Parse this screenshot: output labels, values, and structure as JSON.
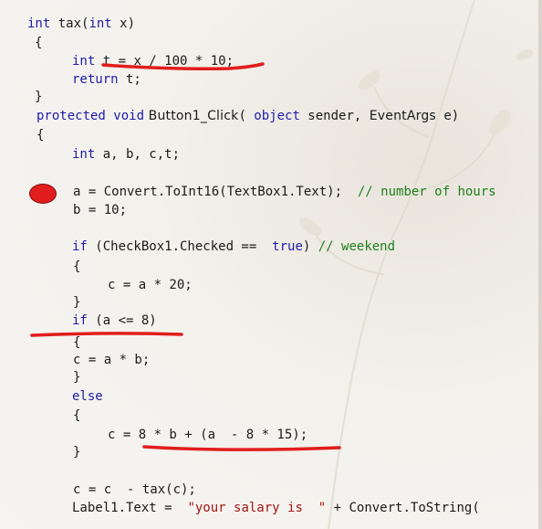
{
  "code": {
    "l1": {
      "kw1": "int",
      "t1": " tax(",
      "kw2": "int",
      "t2": " x)"
    },
    "l2": "{",
    "l3": {
      "kw1": "int",
      "t1": " t = x / 100 * 10;"
    },
    "l4": {
      "kw1": "return",
      "t1": " t;"
    },
    "l5": "}",
    "l6": {
      "kw1": "protected",
      "kw2": " void",
      "sans1": " Button1_Click",
      "t1": "( ",
      "kw3": "object",
      "t2": " sender, ",
      "sans2": "EventArgs",
      "t3": " e)"
    },
    "l7": "{",
    "l8": {
      "kw1": "int",
      "t1": " a, b, c,t;"
    },
    "l9": {
      "t1": "a = Convert.ToInt16(TextBox1.Text);",
      "cmt": "  // number of hours"
    },
    "l10": "b = 10;",
    "l11": {
      "kw1": "if",
      "t1": " (CheckBox1.Checked ==  ",
      "kw2": "true",
      "t2": ")",
      "cmt": " // weekend"
    },
    "l12": "{",
    "l13": "c = a * 20;",
    "l14": "}",
    "l15": {
      "kw1": "if",
      "t1": " (a <= 8)"
    },
    "l16": "{",
    "l17": "c = a * b;",
    "l18": "}",
    "l19": {
      "kw1": "else"
    },
    "l20": "{",
    "l21": "c = 8 * b + (a  - 8 * 15);",
    "l22": "}",
    "l23": "c = c  - tax(c);",
    "l24": {
      "t1": "Label1.Text = ",
      "str": " \"your salary is  \"",
      "t2": " + Convert.ToString("
    }
  },
  "colors": {
    "keyword": "#1c1ca8",
    "string": "#a31515",
    "comment": "#1e7f1e",
    "annotation": "#e11d1d"
  },
  "annotations": {
    "breakpoint_icon": "breakpoint-icon",
    "underline_marks": [
      "underline-tax-assignment",
      "underline-if-condition",
      "underline-else-expression"
    ]
  }
}
